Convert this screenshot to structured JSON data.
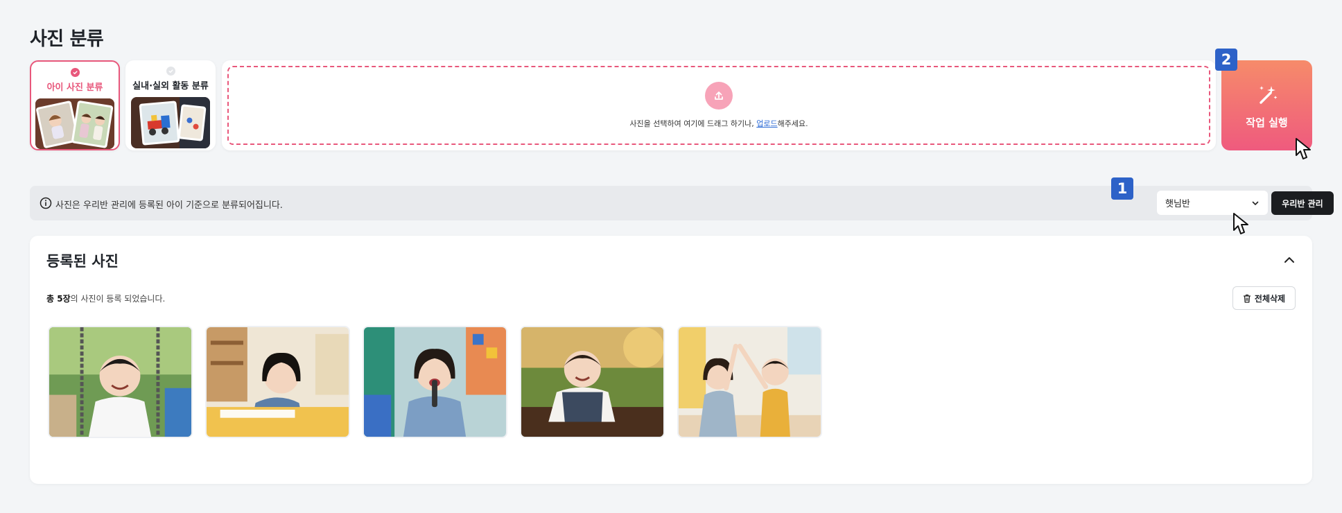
{
  "page": {
    "title": "사진 분류"
  },
  "modes": [
    {
      "label": "아이 사진 분류",
      "selected": true
    },
    {
      "label": "실내·실외 활동 분류",
      "selected": false
    }
  ],
  "upload": {
    "text_before": "사진을 선택하여 여기에 드래그 하기나, ",
    "link_text": "업로드",
    "text_after": "해주세요.",
    "icon": "upload-icon"
  },
  "run_button": {
    "label": "작업 실행",
    "icon": "magic-wand-icon"
  },
  "info_bar": {
    "text": "사진은 우리반 관리에 등록된 아이 기준으로 분류되어집니다.",
    "select_value": "햇님반",
    "manage_label": "우리반 관리"
  },
  "steps": {
    "select": "1",
    "run": "2"
  },
  "registered": {
    "title": "등록된 사진",
    "count_bold": "총 5장",
    "count_rest": "의 사진이 등록 되었습니다.",
    "delete_all_label": "전체삭제",
    "photos": [
      {
        "alt": "child-on-swing"
      },
      {
        "alt": "child-drawing-at-desk"
      },
      {
        "alt": "child-singing-with-microphone"
      },
      {
        "alt": "child-playing-in-soil"
      },
      {
        "alt": "children-high-five"
      }
    ]
  },
  "colors": {
    "accent": "#e8577b",
    "badge": "#2d62c8",
    "dark_button": "#1b1d20"
  }
}
